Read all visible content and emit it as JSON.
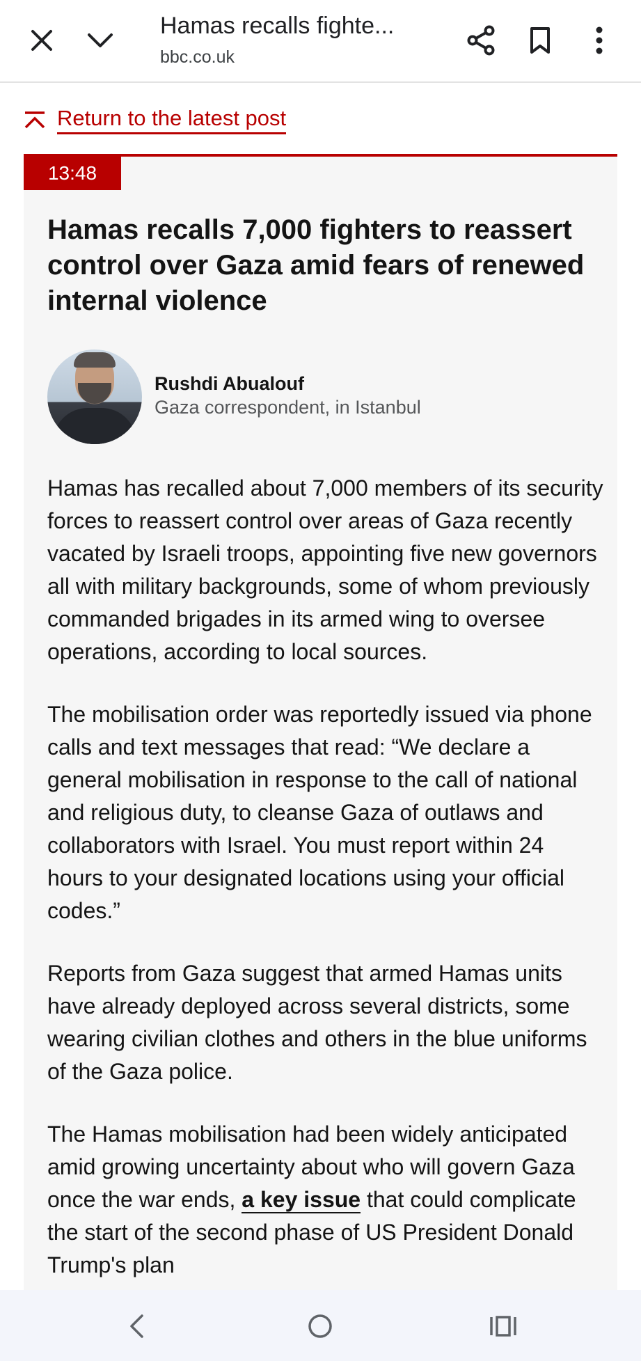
{
  "browser": {
    "page_title": "Hamas recalls fighte...",
    "domain": "bbc.co.uk",
    "icons": [
      "close-icon",
      "chevron-down-icon",
      "share-icon",
      "bookmark-icon",
      "more-vert-icon"
    ]
  },
  "return_link": {
    "label": "Return to the latest post"
  },
  "post": {
    "timestamp": "13:48",
    "headline": "Hamas recalls 7,000 fighters to reassert control over Gaza amid fears of renewed internal violence",
    "author": {
      "name": "Rushdi Abualouf",
      "role": "Gaza correspondent, in Istanbul"
    },
    "paragraphs": [
      "Hamas has recalled about 7,000 members of its security forces to reassert control over areas of Gaza recently vacated by Israeli troops, appointing five new governors all with military backgrounds, some of whom previously commanded brigades in its armed wing to oversee operations, according to local sources.",
      "The mobilisation order was reportedly issued via phone calls and text messages that read: “We declare a general mobilisation in response to the call of national and religious duty, to cleanse Gaza of outlaws and collaborators with Israel. You must report within 24 hours to your designated locations using your official codes.”",
      "Reports from Gaza suggest that armed Hamas units have already deployed across several districts, some wearing civilian clothes and others in the blue uniforms of the Gaza police."
    ],
    "last_paragraph": {
      "before_link": "The Hamas mobilisation had been widely anticipated amid growing uncertainty about who will govern Gaza once the war ends, ",
      "link_text": "a key issue",
      "after_link": " that could complicate the start of the second phase of US President Donald Trump's plan"
    }
  },
  "colors": {
    "accent": "#b80000",
    "card_background": "#f6f6f6",
    "nav_background": "#f3f5fb"
  },
  "system_nav": {
    "icons": [
      "back-icon",
      "home-icon",
      "recents-icon"
    ]
  }
}
